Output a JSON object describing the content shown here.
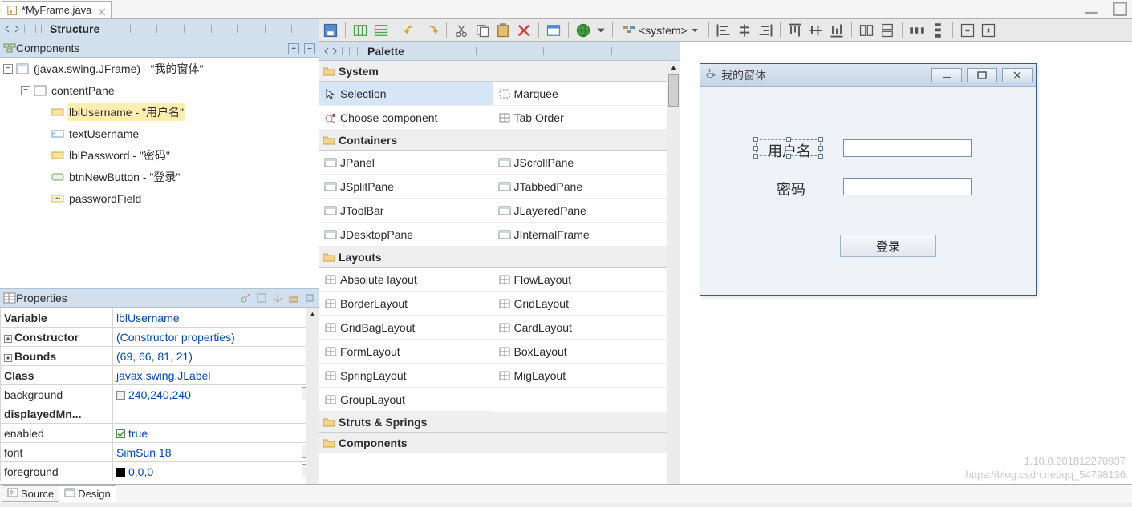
{
  "editor_tab": {
    "title": "*MyFrame.java"
  },
  "structure": {
    "title": "Structure"
  },
  "components_panel": {
    "title": "Components"
  },
  "tree": {
    "root": {
      "label": "(javax.swing.JFrame) - \"我的窗体\"",
      "content": {
        "label": "contentPane",
        "children": [
          {
            "label": "lblUsername - \"用户名\"",
            "selected": true,
            "icon": "label-icon"
          },
          {
            "label": "textUsername",
            "icon": "textfield-icon"
          },
          {
            "label": "lblPassword - \"密码\"",
            "icon": "label-icon"
          },
          {
            "label": "btnNewButton - \"登录\"",
            "icon": "button-icon"
          },
          {
            "label": "passwordField",
            "icon": "password-icon"
          }
        ]
      }
    }
  },
  "properties_panel": {
    "title": "Properties"
  },
  "properties": [
    {
      "name": "Variable",
      "value": "lblUsername",
      "bold": true
    },
    {
      "name": "Constructor",
      "value": "(Constructor properties)",
      "bold": true,
      "expandable": true
    },
    {
      "name": "Bounds",
      "value": "(69, 66, 81, 21)",
      "bold": true,
      "expandable": true
    },
    {
      "name": "Class",
      "value": "javax.swing.JLabel",
      "bold": true
    },
    {
      "name": "background",
      "value": "240,240,240",
      "swatch": true,
      "dots": true
    },
    {
      "name": "displayedMn...",
      "value": "",
      "bold": true
    },
    {
      "name": "enabled",
      "value": "true",
      "checkbox": true
    },
    {
      "name": "font",
      "value": "SimSun 18",
      "dots": true
    },
    {
      "name": "foreground",
      "value": "0,0,0",
      "swatch_black": true,
      "dots": true
    }
  ],
  "toolbar_combo": "<system>",
  "palette": {
    "title": "Palette",
    "sections": [
      {
        "name": "System",
        "items": [
          {
            "label": "Selection",
            "icon": "cursor-icon",
            "selected": true
          },
          {
            "label": "Marquee",
            "icon": "marquee-icon"
          },
          {
            "label": "Choose component",
            "icon": "choose-icon"
          },
          {
            "label": "Tab Order",
            "icon": "taborder-icon"
          }
        ]
      },
      {
        "name": "Containers",
        "items": [
          {
            "label": "JPanel",
            "icon": "jpanel-icon"
          },
          {
            "label": "JScrollPane",
            "icon": "jscroll-icon"
          },
          {
            "label": "JSplitPane",
            "icon": "jsplit-icon"
          },
          {
            "label": "JTabbedPane",
            "icon": "jtab-icon"
          },
          {
            "label": "JToolBar",
            "icon": "jtoolbar-icon"
          },
          {
            "label": "JLayeredPane",
            "icon": "jlayer-icon"
          },
          {
            "label": "JDesktopPane",
            "icon": "jdesktop-icon"
          },
          {
            "label": "JInternalFrame",
            "icon": "jinternal-icon"
          }
        ]
      },
      {
        "name": "Layouts",
        "items": [
          {
            "label": "Absolute layout",
            "icon": "abs-icon"
          },
          {
            "label": "FlowLayout",
            "icon": "flow-icon"
          },
          {
            "label": "BorderLayout",
            "icon": "border-icon"
          },
          {
            "label": "GridLayout",
            "icon": "grid-icon"
          },
          {
            "label": "GridBagLayout",
            "icon": "gridbag-icon"
          },
          {
            "label": "CardLayout",
            "icon": "card-icon"
          },
          {
            "label": "FormLayout",
            "icon": "form-icon"
          },
          {
            "label": "BoxLayout",
            "icon": "box-icon"
          },
          {
            "label": "SpringLayout",
            "icon": "spring-icon"
          },
          {
            "label": "MigLayout",
            "icon": "mig-icon"
          },
          {
            "label": "GroupLayout",
            "icon": "group-icon"
          }
        ]
      },
      {
        "name": "Struts & Springs",
        "collapsed": true
      },
      {
        "name": "Components",
        "collapsed": true
      }
    ]
  },
  "preview_window": {
    "title": "我的窗体",
    "lbl_username": "用户名",
    "lbl_password": "密码",
    "btn_login": "登录"
  },
  "watermark": {
    "line1": "1.10.0.201812270937",
    "line2": "https://blog.csdn.net/qq_54798136"
  },
  "bottom_tabs": {
    "source": "Source",
    "design": "Design"
  }
}
